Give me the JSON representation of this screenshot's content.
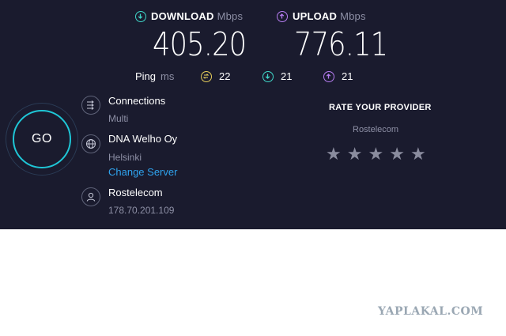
{
  "download": {
    "label": "DOWNLOAD",
    "unit": "Mbps",
    "value": "405.20",
    "icon": "download-arrow-icon",
    "color": "#3fd6c8"
  },
  "upload": {
    "label": "UPLOAD",
    "unit": "Mbps",
    "value": "776.11",
    "icon": "upload-arrow-icon",
    "color": "#b57cf0"
  },
  "ping": {
    "label": "Ping",
    "unit": "ms",
    "idle": {
      "value": "22",
      "icon": "ping-jitter-icon",
      "color": "#e8cf5a"
    },
    "download": {
      "value": "21",
      "icon": "download-latency-icon",
      "color": "#3fd6c8"
    },
    "upload": {
      "value": "21",
      "icon": "upload-latency-icon",
      "color": "#b57cf0"
    }
  },
  "go_button": {
    "label": "GO",
    "color": "#1fc6d6"
  },
  "connections": {
    "title": "Connections",
    "mode": "Multi",
    "icon": "connections-icon"
  },
  "server": {
    "name": "DNA Welho Oy",
    "city": "Helsinki",
    "change_label": "Change Server",
    "icon": "globe-icon"
  },
  "provider": {
    "name": "Rostelecom",
    "ip": "178.70.201.109",
    "icon": "user-icon"
  },
  "rating": {
    "title": "RATE YOUR PROVIDER",
    "provider": "Rostelecom",
    "stars": 5,
    "selected": 0
  },
  "watermark": "YAPLAKAL.COM"
}
